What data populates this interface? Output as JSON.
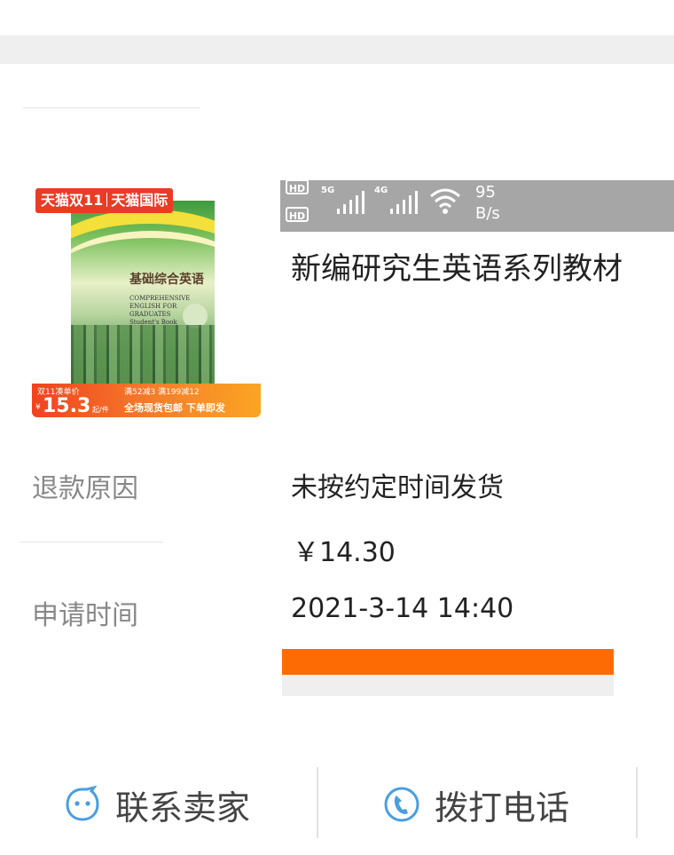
{
  "product": {
    "image_badge_left": "天猫双11",
    "image_badge_right": "天猫国际",
    "book_title_cn": "基础综合英语",
    "book_title_en": "COMPREHENSIVE ENGLISH FOR GRADUATES",
    "book_subtitle": "Student's Book",
    "price_label": "双11凑单价",
    "currency": "¥",
    "price": "15.3",
    "price_unit": "起/件",
    "promo_line1": "满52减3   满199减12",
    "promo_line2": "全场现货包邮 下单即发",
    "title": "新编研究生英语系列教材"
  },
  "statusbar": {
    "hd1": "HD",
    "hd2": "HD",
    "net1": "5G",
    "net2": "4G",
    "speed_value": "95",
    "speed_unit": "B/s"
  },
  "refund": {
    "reason_label": "退款原因",
    "reason_value": "未按约定时间发货",
    "amount_value": "￥14.30",
    "time_label": "申请时间",
    "time_value": "2021-3-14 14:40",
    "progress_fraction": 1.0,
    "progress_color": "#fd6b04"
  },
  "actions": {
    "contact_seller": "联系卖家",
    "call_phone": "拨打电话",
    "icon_color": "#4a9ee0"
  }
}
